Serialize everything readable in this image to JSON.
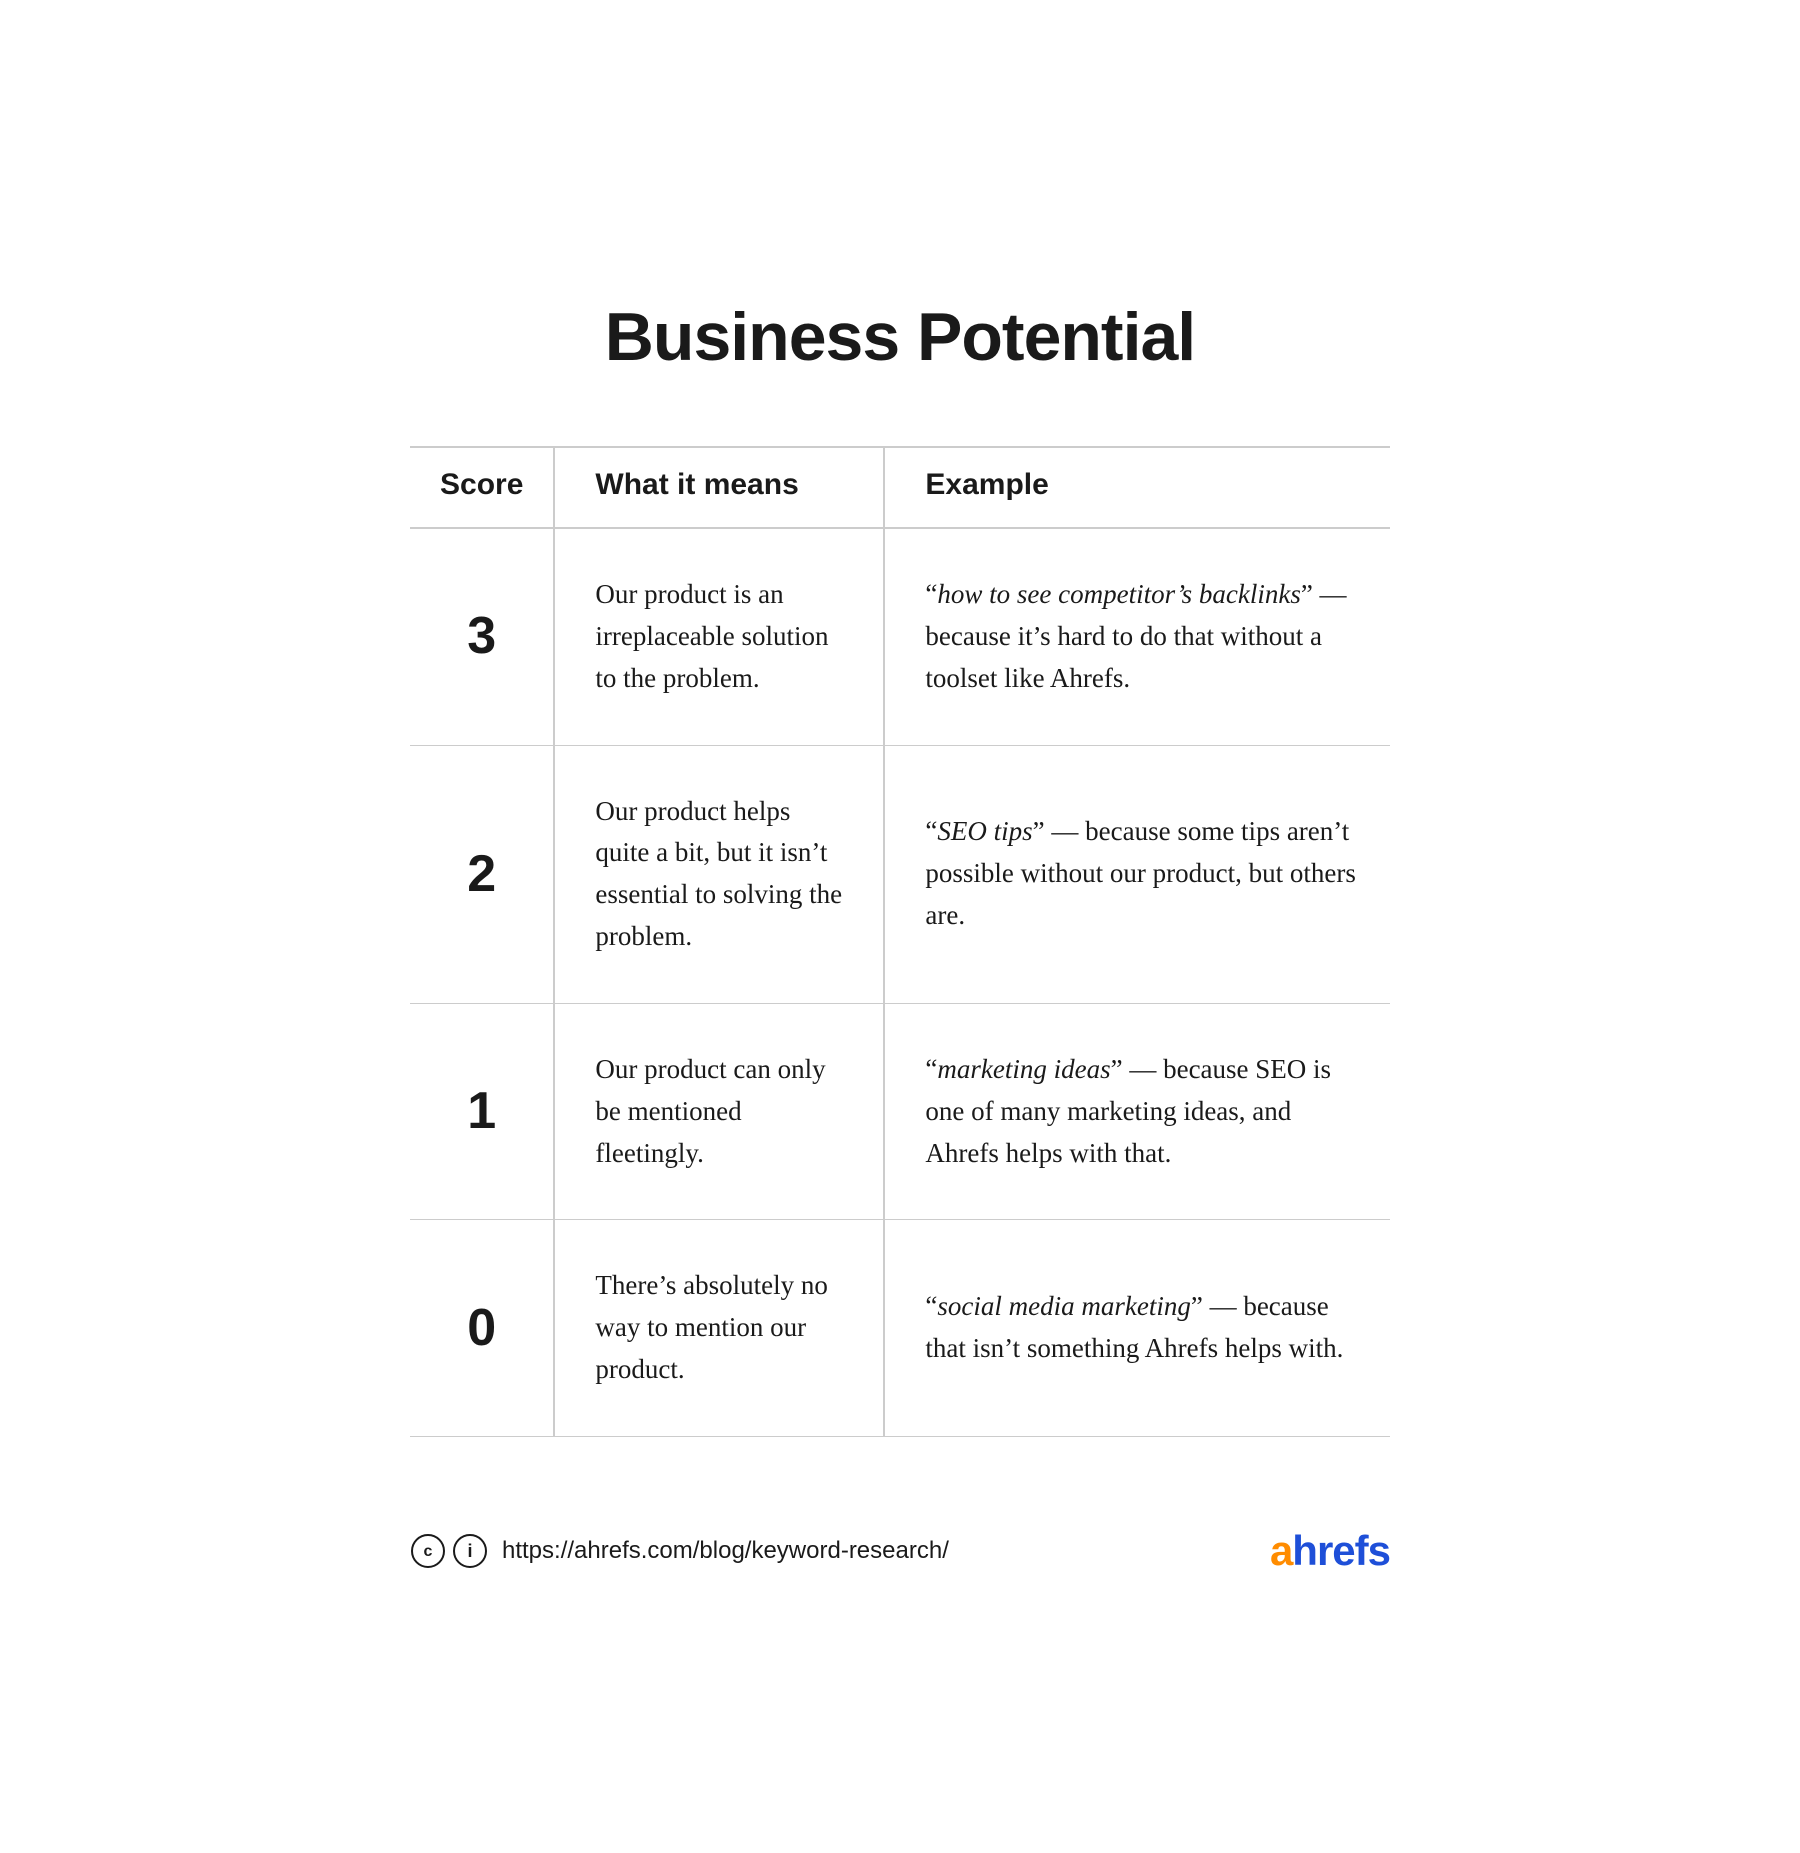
{
  "page": {
    "title": "Business Potential",
    "background": "#ffffff"
  },
  "table": {
    "headers": {
      "score": "Score",
      "meaning": "What it means",
      "example": "Example"
    },
    "rows": [
      {
        "score": "3",
        "meaning": "Our product is an irreplaceable solution to the problem.",
        "example_italic": "how to see competitor’s backlinks",
        "example_rest": " — because it’s hard to do that without a toolset like Ahrefs."
      },
      {
        "score": "2",
        "meaning": "Our product helps quite a bit, but it isn’t essential to solving the problem.",
        "example_italic": "SEO tips",
        "example_rest": " — because some tips aren’t possible without our product, but others are."
      },
      {
        "score": "1",
        "meaning": "Our product can only be mentioned fleetingly.",
        "example_italic": "marketing ideas",
        "example_rest": " — because SEO is one of many marketing ideas, and Ahrefs helps with that."
      },
      {
        "score": "0",
        "meaning": "There’s absolutely no way to mention our product.",
        "example_italic": "social media marketing",
        "example_rest": " — because that isn’t something Ahrefs helps with."
      }
    ]
  },
  "footer": {
    "url": "https://ahrefs.com/blog/keyword-research/",
    "logo_a": "a",
    "logo_hrefs": "hrefs"
  }
}
